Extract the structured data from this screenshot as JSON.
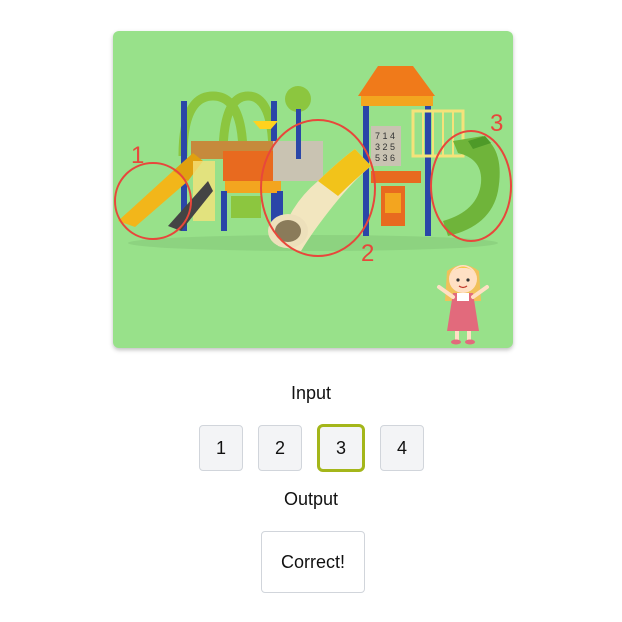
{
  "scene": {
    "description_icon": "playground-illustration",
    "markers": [
      "1",
      "2",
      "3"
    ],
    "accent_color": "#e8473b",
    "background_color": "#98e18a"
  },
  "input": {
    "label": "Input",
    "options": [
      "1",
      "2",
      "3",
      "4"
    ],
    "selected": "3",
    "selected_border_color": "#a4b61a"
  },
  "output": {
    "label": "Output",
    "value": "Correct!"
  }
}
